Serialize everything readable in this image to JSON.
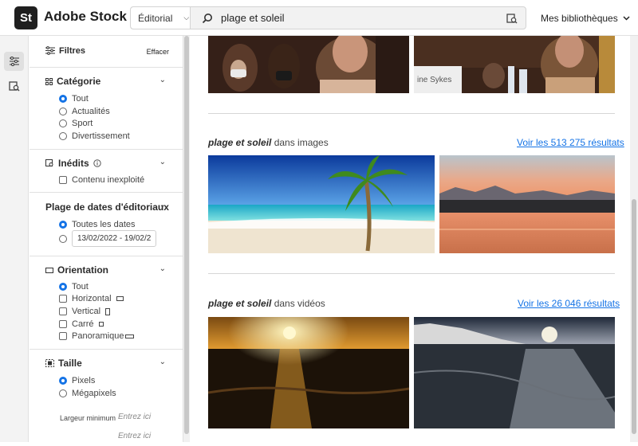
{
  "app": {
    "logo": "St",
    "brand": "Adobe Stock",
    "libraries": "Mes bibliothèques"
  },
  "search": {
    "scope": "Éditorial",
    "query": "plage et soleil"
  },
  "filters": {
    "title": "Filtres",
    "clear": "Effacer",
    "category": {
      "title": "Catégorie",
      "options": [
        "Tout",
        "Actualités",
        "Sport",
        "Divertissement"
      ],
      "selected": 0
    },
    "unused": {
      "title": "Inédits",
      "option": "Contenu inexploité"
    },
    "date_range": {
      "title": "Plage de dates d'éditoriaux",
      "all_label": "Toutes les dates",
      "range": "13/02/2022 - 19/02/2"
    },
    "orientation": {
      "title": "Orientation",
      "options": [
        "Tout",
        "Horizontal",
        "Vertical",
        "Carré",
        "Panoramique"
      ],
      "selected": 0
    },
    "size": {
      "title": "Taille",
      "options": [
        "Pixels",
        "Mégapixels"
      ],
      "selected": 0,
      "min_width_label": "Largeur minimum",
      "placeholder": "Entrez ici"
    }
  },
  "results": {
    "images": {
      "query": "plage et soleil",
      "suffix": " dans images",
      "link": "Voir les 513 275 résultats"
    },
    "videos": {
      "query": "plage et soleil",
      "suffix": " dans vidéos",
      "link": "Voir les 26 046 résultats"
    },
    "top_photos": [
      "editorial-woman-mask",
      "editorial-woman-sykes"
    ],
    "sykes_label": "ine Sykes"
  },
  "colors": {
    "accent": "#1473e6",
    "dark": "#1f1f1f"
  }
}
